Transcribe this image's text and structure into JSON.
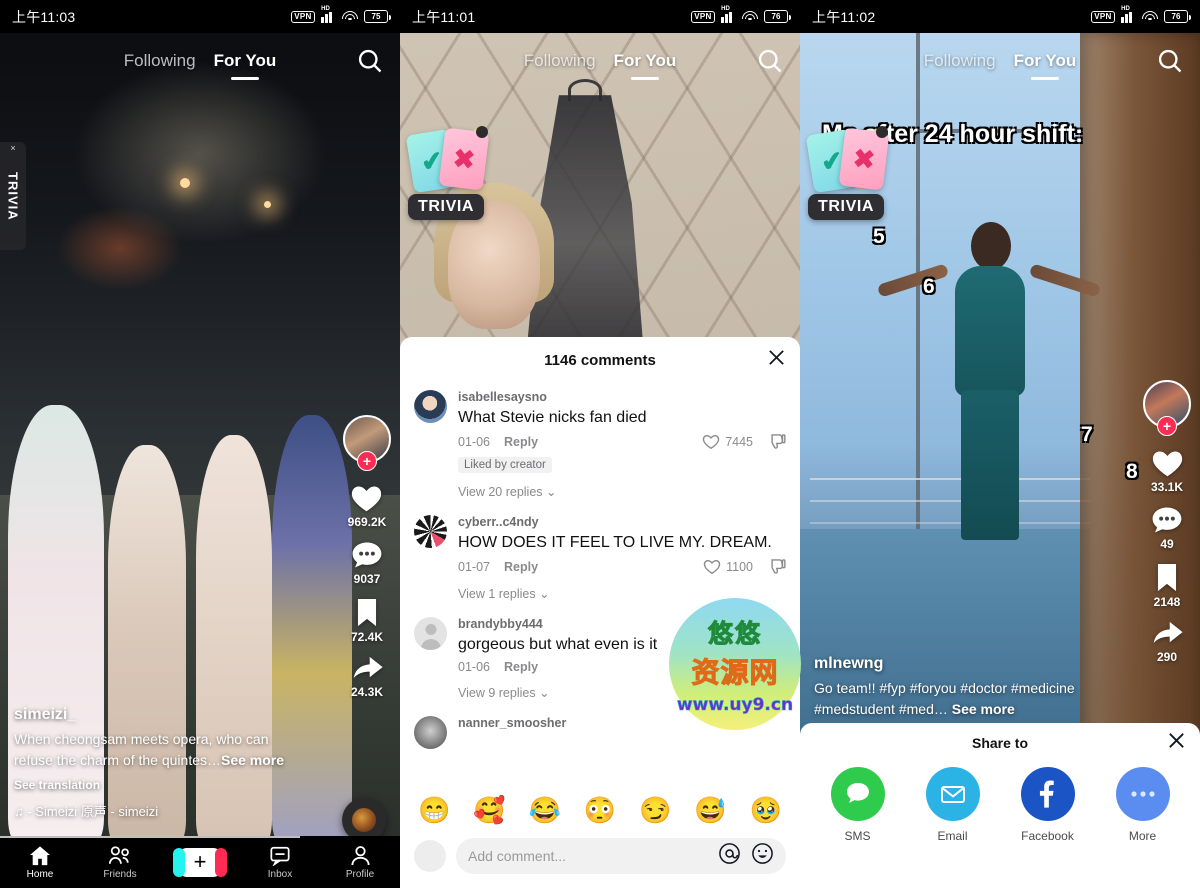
{
  "panels": [
    {
      "status": {
        "time": "上午11:03",
        "vpn": "VPN",
        "hd": "HD",
        "battery": "75"
      },
      "nav": {
        "following": "Following",
        "for_you": "For You",
        "search_icon": "search-icon"
      },
      "trivia_tab": {
        "label": "TRIVIA",
        "close": "×"
      },
      "rail": {
        "follow_plus": "+",
        "likes": "969.2K",
        "comments": "9037",
        "bookmarks": "72.4K",
        "shares": "24.3K"
      },
      "caption": {
        "username": "simeizi_",
        "description": "When cheongsam meets opera, who can refuse the charm of the quintes…",
        "see_more": "See more",
        "translate": "See translation",
        "music": "♫  - Simeizi   原声 - simeizi"
      },
      "tabbar": [
        {
          "name": "home",
          "label": "Home"
        },
        {
          "name": "friends",
          "label": "Friends"
        },
        {
          "name": "create",
          "label": "+"
        },
        {
          "name": "inbox",
          "label": "Inbox"
        },
        {
          "name": "profile",
          "label": "Profile"
        }
      ]
    },
    {
      "status": {
        "time": "上午11:01",
        "vpn": "VPN",
        "hd": "HD",
        "battery": "76"
      },
      "nav": {
        "following": "Following",
        "for_you": "For You",
        "search_icon": "search-icon"
      },
      "trivia": {
        "label": "TRIVIA"
      },
      "comments_sheet": {
        "title": "1146 comments",
        "close": "×",
        "items": [
          {
            "username": "isabellesaysno",
            "text": "What Stevie nicks fan died",
            "date": "01-06",
            "reply": "Reply",
            "likes": "7445",
            "liked_by_creator": "Liked by creator",
            "view_replies": "View 20 replies"
          },
          {
            "username": "cyberr..c4ndy",
            "text": "HOW DOES IT FEEL TO LIVE MY. DREAM.",
            "date": "01-07",
            "reply": "Reply",
            "likes": "1100",
            "liked_by_creator": "",
            "view_replies": "View 1 replies"
          },
          {
            "username": "brandybby444",
            "text": "gorgeous but what even is it",
            "date": "01-06",
            "reply": "Reply",
            "likes": "",
            "liked_by_creator": "",
            "view_replies": "View 9 replies"
          },
          {
            "username": "nanner_smoosher",
            "text": "",
            "date": "",
            "reply": "",
            "likes": "",
            "liked_by_creator": "",
            "view_replies": ""
          }
        ],
        "emojis": [
          "😁",
          "🥰",
          "😂",
          "😳",
          "😏",
          "😅",
          "🥹"
        ],
        "input_placeholder": "Add comment...",
        "mention_icon": "at-icon",
        "emoji_icon": "emoji-icon"
      }
    },
    {
      "status": {
        "time": "上午11:02",
        "vpn": "VPN",
        "hd": "HD",
        "battery": "76"
      },
      "nav": {
        "following": "Following",
        "for_you": "For You",
        "search_icon": "search-icon"
      },
      "trivia": {
        "label": "TRIVIA"
      },
      "video_text": "Me after 24 hour shift:",
      "number_tags": [
        "5",
        "6",
        "7",
        "8"
      ],
      "rail": {
        "follow_plus": "+",
        "likes": "33.1K",
        "comments": "49",
        "bookmarks": "2148",
        "shares": "290"
      },
      "caption": {
        "username": "mlnewng",
        "description": "Go team!! #fyp #foryou #doctor #medicine #medstudent #med…",
        "see_more": "See more"
      },
      "share_sheet": {
        "title": "Share to",
        "close": "×",
        "targets": [
          {
            "name": "sms",
            "label": "SMS",
            "color": "#2fcb4c"
          },
          {
            "name": "email",
            "label": "Email",
            "color": "#2bb3e6"
          },
          {
            "name": "facebook",
            "label": "Facebook",
            "color": "#1b54c4"
          },
          {
            "name": "more",
            "label": "More",
            "color": "#5b8df0"
          }
        ]
      }
    }
  ],
  "watermark": {
    "line1": "悠悠",
    "line2": "资源网",
    "line3": "www.uy9.cn"
  }
}
